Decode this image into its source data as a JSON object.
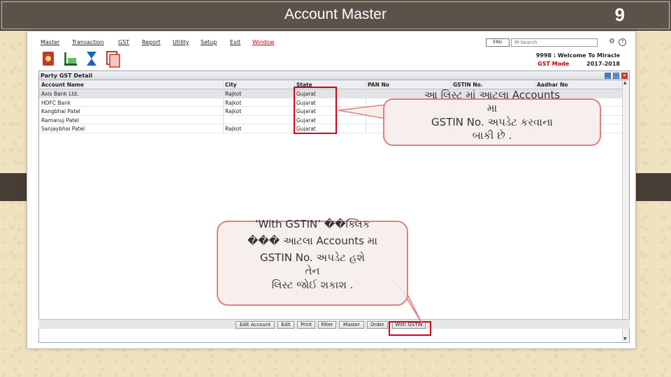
{
  "slide": {
    "title": "Account Master",
    "page_number": "9"
  },
  "menu": {
    "items": [
      "Master",
      "Transaction",
      "GST",
      "Report",
      "Utility",
      "Setup",
      "Exit",
      "Window"
    ],
    "language": "ENG",
    "search_placeholder": "M-Search",
    "settings_icon": "gear-icon",
    "help_icon": "help-icon"
  },
  "toolbar_icons": [
    "ledger-icon",
    "inventory-icon",
    "hourglass-icon",
    "report-icon"
  ],
  "status": {
    "welcome": "9998 : Welcome To Miracle",
    "mode": "GST Mode",
    "year": "2017-2018"
  },
  "panel": {
    "title": "Party GST Detail",
    "columns": [
      "Account Name",
      "City",
      "State",
      "PAN No",
      "GSTIN No.",
      "Aadhar No"
    ],
    "rows": [
      [
        "Axis Bank Ltd.",
        "Rajkot",
        "Gujarat",
        "",
        "",
        ""
      ],
      [
        "HDFC Bank",
        "Rajkot",
        "Gujarat",
        "",
        "",
        ""
      ],
      [
        "Kangbhai Patel",
        "Rajkot",
        "Gujarat",
        "",
        "",
        ""
      ],
      [
        "Ramanuj Patel",
        "",
        "Gujarat",
        "",
        "",
        ""
      ],
      [
        "Sanjaybhai Patel",
        "Rajkot",
        "Gujarat",
        "",
        "",
        ""
      ]
    ],
    "buttons": [
      "Edit Account",
      "Edit",
      "Print",
      "Filter",
      "Master",
      "Order",
      "With GSTIN"
    ]
  },
  "callouts": {
    "top": [
      "આ લિસ્ટ  માં આટલા  Accounts",
      "મા",
      "GSTIN No. અપડેટ  કરવાના",
      "બાકી  છે ."
    ],
    "bottom": [
      "‘With GSTIN’ ��ક્લિક",
      "��� આટલા   Accounts મા",
      "GSTIN No. અપડેટ   હશે",
      "તેન",
      "લિસ્ટ  જોઈ  શકાશ   ."
    ]
  },
  "colors": {
    "highlight": "#d0021b",
    "callout_border": "#e08080",
    "gst_mode": "#c00000",
    "title_bar": "#5b5349"
  }
}
